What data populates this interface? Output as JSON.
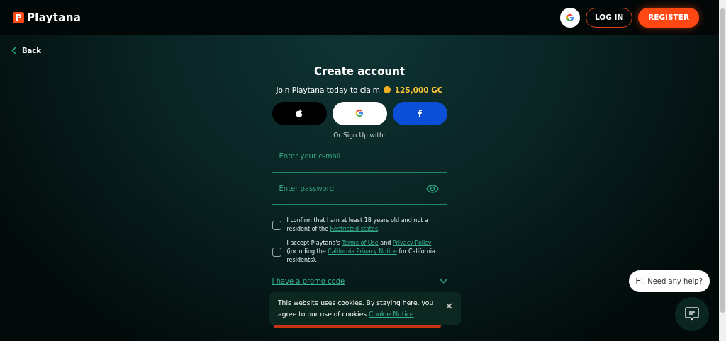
{
  "header": {
    "logo_text": "Playtana",
    "buttons": [
      {
        "kind": "google"
      },
      {
        "kind": "outline",
        "label": "LOG IN"
      },
      {
        "kind": "primary",
        "label": "REGISTER"
      }
    ]
  },
  "back": {
    "label": "Back"
  },
  "form": {
    "title": "Create account",
    "subtitle": "Join Playtana today to claim",
    "reward": "125,000 GC",
    "social": [
      {
        "kind": "apple"
      },
      {
        "kind": "google"
      },
      {
        "kind": "facebook"
      }
    ],
    "divider_text": "Or Sign Up with:",
    "fields": [
      {
        "placeholder": "Enter your e-mail",
        "kind": "email"
      },
      {
        "placeholder": "Enter password",
        "kind": "password"
      }
    ],
    "checks": [
      {
        "checked": false,
        "parts": [
          {
            "kind": "text",
            "text": "I confirm that I am at least 18 years old and not a resident of the "
          },
          {
            "kind": "link",
            "text": "Restricted states"
          },
          {
            "kind": "text",
            "text": "."
          }
        ]
      },
      {
        "checked": false,
        "parts": [
          {
            "kind": "text",
            "text": "I accept Playtana's "
          },
          {
            "kind": "link",
            "text": "Terms of Use"
          },
          {
            "kind": "text",
            "text": " and "
          },
          {
            "kind": "link",
            "text": "Privacy Policy"
          },
          {
            "kind": "text",
            "text": " (including the "
          },
          {
            "kind": "link",
            "text": "California Privacy Notice"
          },
          {
            "kind": "text",
            "text": " for California residents)."
          }
        ]
      }
    ],
    "promo": {
      "label": "I have a promo code",
      "expanded": false
    }
  },
  "cookie": {
    "text": "This website uses cookies. By staying here, you agree to our use of cookies.",
    "link": "Cookie Notice"
  },
  "chat": {
    "bubble": "Hi. Need any help?"
  }
}
